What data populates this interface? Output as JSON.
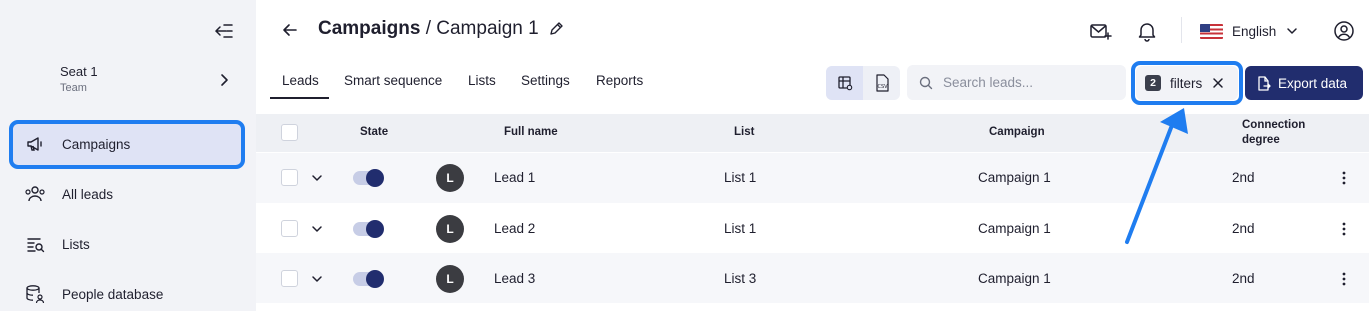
{
  "sidebar": {
    "seat": {
      "name": "Seat 1",
      "subtitle": "Team"
    },
    "items": [
      {
        "label": "Campaigns",
        "icon": "megaphone-icon",
        "active": true
      },
      {
        "label": "All leads",
        "icon": "people-icon"
      },
      {
        "label": "Lists",
        "icon": "list-search-icon"
      },
      {
        "label": "People database",
        "icon": "database-user-icon"
      }
    ]
  },
  "header": {
    "breadcrumb_root": "Campaigns",
    "separator": " / ",
    "campaign_name": "Campaign 1",
    "language": "English"
  },
  "tabs": [
    "Leads",
    "Smart sequence",
    "Lists",
    "Settings",
    "Reports"
  ],
  "toolbar": {
    "search_placeholder": "Search leads...",
    "filters_count": "2",
    "filters_label": "filters",
    "export_label": "Export data"
  },
  "table": {
    "columns": {
      "state": "State",
      "full_name": "Full name",
      "list": "List",
      "campaign": "Campaign",
      "connection_degree_line1": "Connection",
      "connection_degree_line2": "degree"
    },
    "rows": [
      {
        "avatar": "L",
        "name": "Lead 1",
        "list": "List 1",
        "campaign": "Campaign 1",
        "degree": "2nd",
        "state_on": true
      },
      {
        "avatar": "L",
        "name": "Lead 2",
        "list": "List 1",
        "campaign": "Campaign 1",
        "degree": "2nd",
        "state_on": true
      },
      {
        "avatar": "L",
        "name": "Lead 3",
        "list": "List 3",
        "campaign": "Campaign 1",
        "degree": "2nd",
        "state_on": true
      }
    ]
  },
  "colors": {
    "primary": "#212d6e",
    "highlight": "#1f7df0",
    "sidebar_bg": "#f2f3f7"
  }
}
